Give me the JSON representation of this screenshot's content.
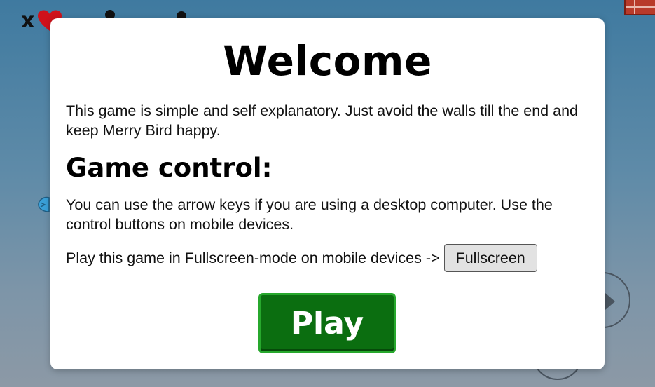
{
  "hud": {
    "lives_prefix": "x"
  },
  "modal": {
    "title": "Welcome",
    "intro": "This game is simple and self explanatory. Just avoid the walls till the end and keep Merry Bird happy.",
    "controls_heading": "Game control:",
    "controls_text": "You can use the arrow keys if you are using a desktop computer. Use the control buttons on mobile devices.",
    "fullscreen_prompt": "Play this game in Fullscreen-mode on mobile devices ->",
    "fullscreen_button": "Fullscreen",
    "play_button": "Play"
  },
  "colors": {
    "play_button_bg": "#0b6e10",
    "play_button_border": "#27a82d",
    "heart": "#d0121b",
    "brick": "#b83a2a"
  },
  "icons": [
    "heart-icon",
    "brick-wall",
    "bird",
    "arrow-right-icon"
  ]
}
